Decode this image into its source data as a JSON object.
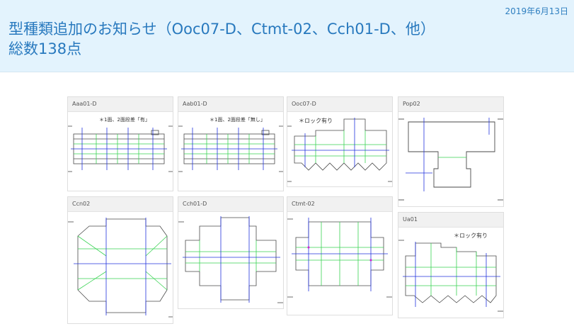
{
  "header": {
    "date": "2019年6月13日",
    "title": "型種類追加のお知らせ（Ooc07-D、Ctmt-02、Cch01-D、他） 総数138点"
  },
  "cards": [
    {
      "label": "Aaa01-D",
      "note": "＊1面、2面段差「有」"
    },
    {
      "label": "Aab01-D",
      "note": "＊1面、2面段差「無し」"
    },
    {
      "label": "Ooc07-D",
      "note": "＊ロック有り"
    },
    {
      "label": "Pop02",
      "note": ""
    },
    {
      "label": "Ccn02",
      "note": ""
    },
    {
      "label": "Cch01-D",
      "note": ""
    },
    {
      "label": "Ctmt-02",
      "note": ""
    },
    {
      "label": "Ua01",
      "note": "＊ロック有り"
    }
  ],
  "colors": {
    "header_bg": "#e3f3fd",
    "title": "#2879be",
    "cut_line": "#4a4a4a",
    "crease_green": "#39d353",
    "crease_blue": "#2233dd",
    "crease_magenta": "#d020d0"
  }
}
